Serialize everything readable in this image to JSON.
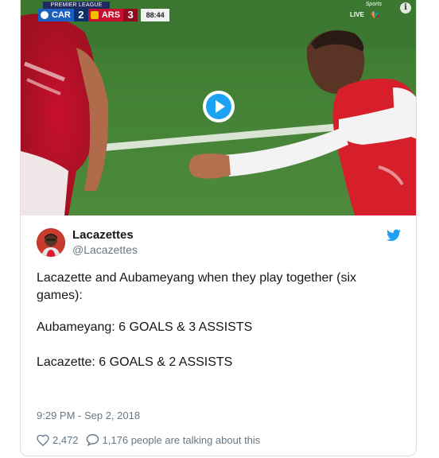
{
  "video": {
    "scorebug": {
      "league": "PREMIER LEAGUE",
      "home_team": "CAR",
      "home_score": "2",
      "away_team": "ARS",
      "away_score": "3",
      "clock": "88:44"
    },
    "broadcaster": {
      "live_label": "LIVE",
      "network_label": "NBC",
      "sports_label": "Sports"
    },
    "info_label": "i"
  },
  "tweet": {
    "author_name": "Lacazettes",
    "author_handle": "@Lacazettes",
    "text_line1": "Lacazette and Aubameyang when they play together (six games):",
    "text_line2": "Aubameyang: 6 GOALS & 3 ASSISTS",
    "text_line3": "Lacazette: 6 GOALS & 2 ASSISTS",
    "timestamp": "9:29 PM - Sep 2, 2018",
    "like_count": "2,472",
    "conversation_text": "1,176 people are talking about this"
  },
  "colors": {
    "twitter_blue": "#1da1f2",
    "text_primary": "#14171a",
    "text_secondary": "#657786",
    "arsenal_red": "#d71f2b"
  },
  "icons": [
    "play-icon",
    "twitter-bird-icon",
    "heart-icon",
    "comment-icon",
    "info-icon"
  ]
}
